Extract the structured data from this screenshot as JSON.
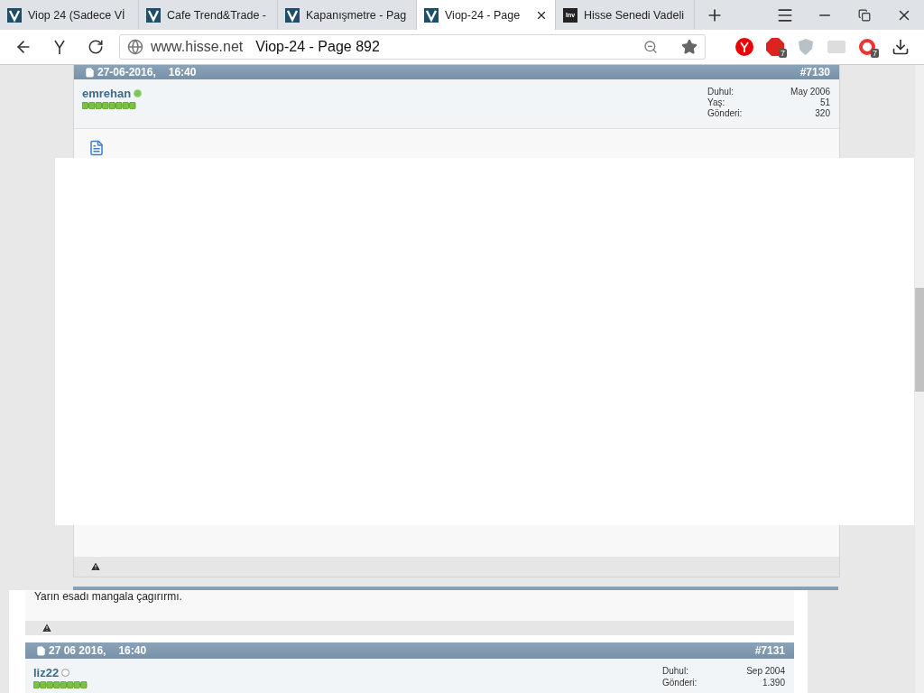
{
  "browser": {
    "tabs": [
      {
        "title": "Viop 24 (Sadece Vİ",
        "kind": "v",
        "selected": false
      },
      {
        "title": "Cafe Trend&Trade -",
        "kind": "v",
        "selected": false
      },
      {
        "title": "Kapanışmetre - Pag",
        "kind": "v",
        "selected": false
      },
      {
        "title": "Viop-24 - Page",
        "kind": "v",
        "selected": true
      },
      {
        "title": "Hisse Senedi Vadeli",
        "kind": "inv",
        "icon_text": "Inv",
        "selected": false
      }
    ],
    "address": {
      "host": "www.hisse.net",
      "page_title": "Viop-24 - Page 892"
    },
    "extension_badges": [
      "7",
      "7"
    ]
  },
  "post": {
    "date": "27-06-2016,",
    "time": "16:40",
    "number": "#7130",
    "user": {
      "name": "emrehan",
      "online": true
    },
    "stats": [
      {
        "label": "Duhul:",
        "value": "May 2006"
      },
      {
        "label": "Yaş:",
        "value": "51"
      },
      {
        "label": "Gönderi:",
        "value": "320"
      }
    ]
  },
  "pasted_fragment": {
    "message": "Yarın esadı mangala çagırırmı.",
    "post": {
      "date": "27 06 2016,",
      "time": "16:40",
      "number": "#7131",
      "user": {
        "name": "liz22",
        "online": false
      },
      "stats": [
        {
          "label": "Duhul:",
          "value": "Sep 2004"
        },
        {
          "label": "Gönderi:",
          "value": "1.390"
        }
      ]
    }
  }
}
